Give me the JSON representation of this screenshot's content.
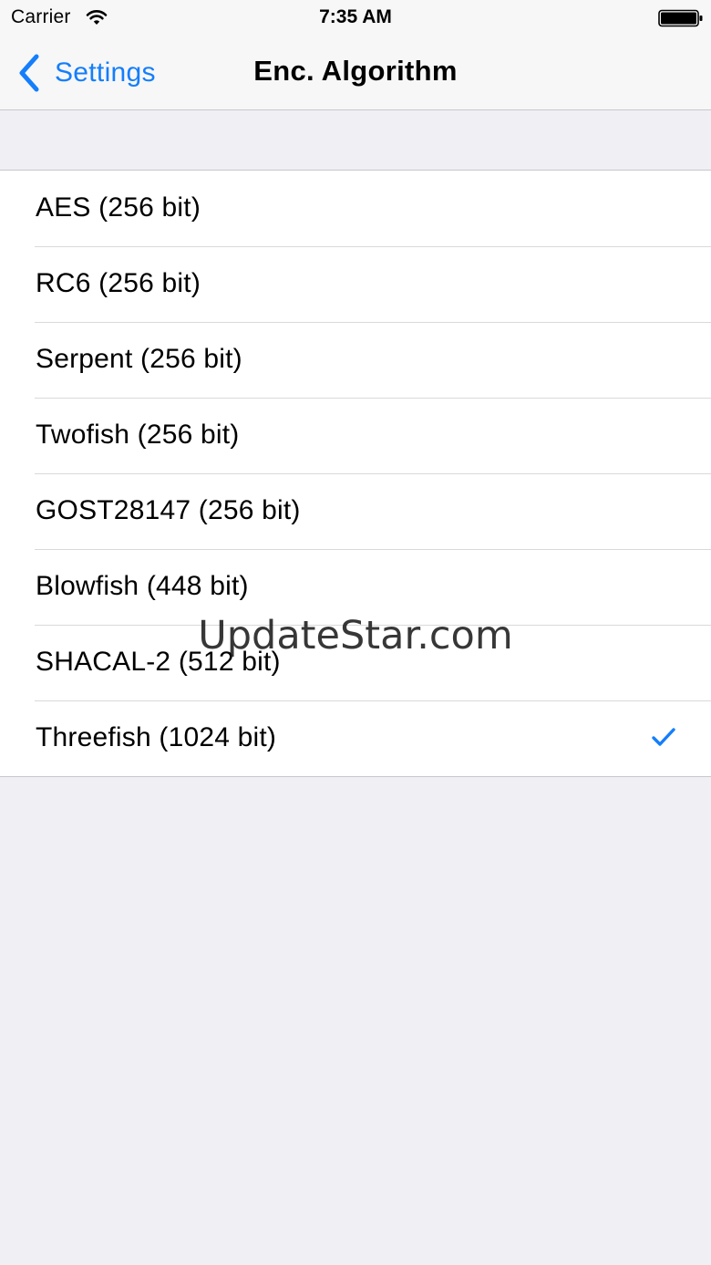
{
  "status_bar": {
    "carrier": "Carrier",
    "time": "7:35 AM",
    "wifi_icon": "wifi-icon",
    "battery_icon": "battery-full-icon"
  },
  "nav": {
    "back_label": "Settings",
    "back_icon": "chevron-left-icon",
    "title": "Enc. Algorithm"
  },
  "algorithms": [
    {
      "label": "AES (256 bit)",
      "selected": false
    },
    {
      "label": "RC6 (256 bit)",
      "selected": false
    },
    {
      "label": "Serpent (256 bit)",
      "selected": false
    },
    {
      "label": "Twofish (256 bit)",
      "selected": false
    },
    {
      "label": "GOST28147 (256 bit)",
      "selected": false
    },
    {
      "label": "Blowfish (448 bit)",
      "selected": false
    },
    {
      "label": "SHACAL-2 (512 bit)",
      "selected": false
    },
    {
      "label": "Threefish (1024 bit)",
      "selected": true
    }
  ],
  "watermark": "UpdateStar.com",
  "colors": {
    "accent": "#147efb",
    "background": "#efeff4",
    "separator": "#c8c7cc"
  }
}
